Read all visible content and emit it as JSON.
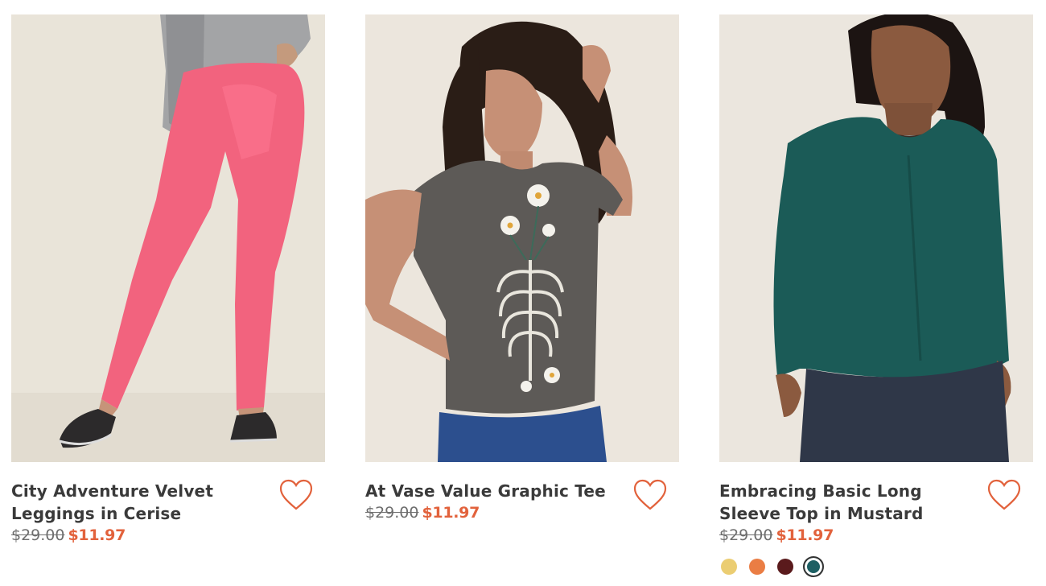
{
  "accent_color": "#e2623c",
  "products": [
    {
      "title": "City Adventure Velvet Leggings in Cerise",
      "original_price": "$29.00",
      "sale_price": "$11.97",
      "image_alt": "Model wearing pink velvet leggings, grey sweatshirt and black sneakers"
    },
    {
      "title": "At Vase Value Graphic Tee",
      "original_price": "$29.00",
      "sale_price": "$11.97",
      "image_alt": "Model wearing grey tee with skeleton ribcage and daisies graphic"
    },
    {
      "title": "Embracing Basic Long Sleeve Top in Mustard",
      "original_price": "$29.00",
      "sale_price": "$11.97",
      "image_alt": "Model wearing teal long sleeve v-neck top and jeans",
      "swatches": [
        {
          "name": "mustard",
          "color": "#ebcd72"
        },
        {
          "name": "orange",
          "color": "#ea7d44"
        },
        {
          "name": "burgundy",
          "color": "#5a1a1c"
        },
        {
          "name": "teal",
          "color": "#1d5f63",
          "selected": true
        }
      ]
    }
  ]
}
